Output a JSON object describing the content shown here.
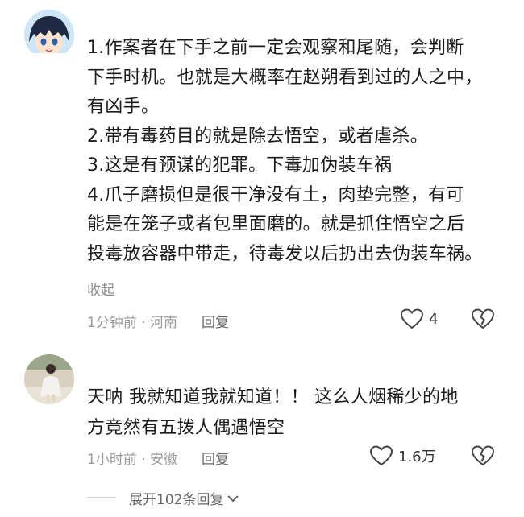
{
  "comments": [
    {
      "lines": [
        "1.作案者在下手之前一定会观察和尾随，会判断",
        "下手时机。也就是大概率在赵朔看到过的人之中，",
        "有凶手。",
        "2.带有毒药目的就是除去悟空，或者虐杀。",
        "3.这是有预谋的犯罪。下毒加伪装车祸",
        "4.爪子磨损但是很干净没有土，肉垫完整，有可",
        "能是在笼子或者包里面磨的。就是抓住悟空之后",
        "投毒放容器中带走，待毒发以后扔出去伪装车祸。"
      ],
      "collapse_label": "收起",
      "meta": "1分钟前 · 河南",
      "reply_label": "回复",
      "like_count": "4"
    },
    {
      "lines": [
        "天呐  我就知道我就知道！！ 这么人烟稀少的地",
        "方竟然有五拨人偶遇悟空"
      ],
      "meta": "1小时前 · 安徽",
      "reply_label": "回复",
      "like_count": "1.6万"
    }
  ],
  "expand_label": "展开102条回复",
  "icons": {
    "like": "heart-outline-icon",
    "dislike": "broken-heart-icon",
    "expand": "chevron-down-icon"
  },
  "colors": {
    "text": "#1c1c1c",
    "meta": "#9a9a9a"
  }
}
